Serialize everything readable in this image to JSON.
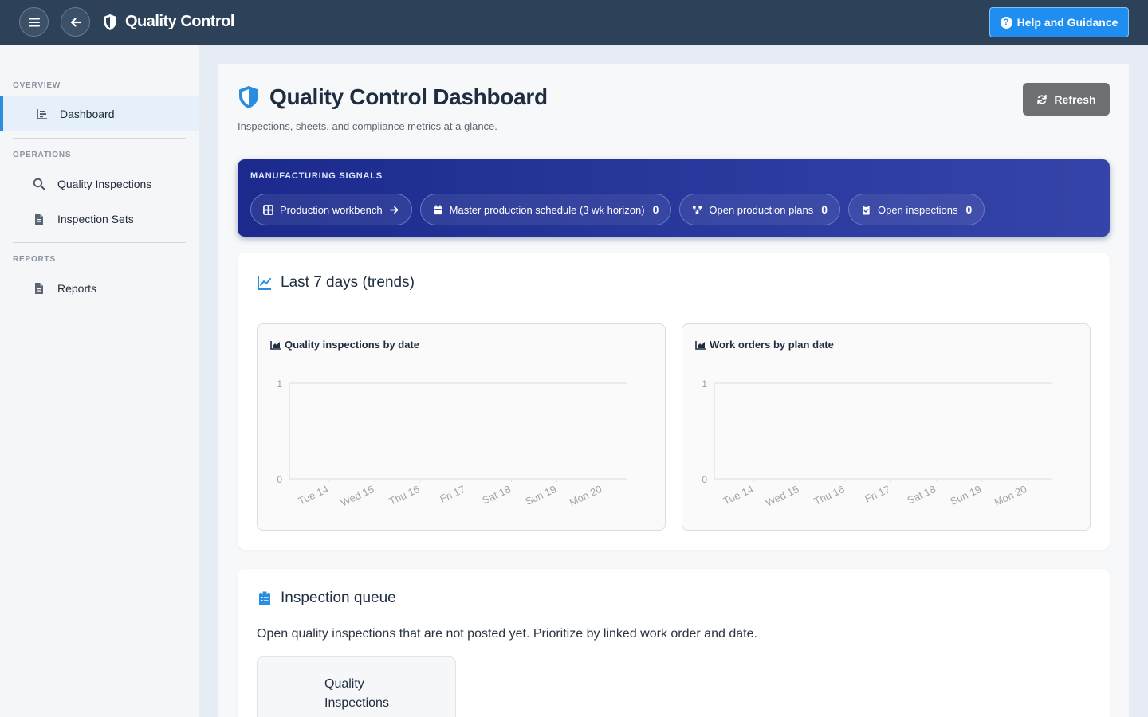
{
  "topbar": {
    "app_title": "Quality Control",
    "help_label": "Help and Guidance",
    "menu_icon": "hamburger-icon",
    "back_icon": "arrow-left-icon",
    "brand_icon": "shield-icon"
  },
  "sidebar": {
    "sections": [
      {
        "label": "OVERVIEW",
        "items": [
          {
            "label": "Dashboard",
            "icon": "chart-bar-icon",
            "active": true
          }
        ]
      },
      {
        "label": "OPERATIONS",
        "items": [
          {
            "label": "Quality Inspections",
            "icon": "search-icon"
          },
          {
            "label": "Inspection Sets",
            "icon": "document-icon"
          }
        ]
      },
      {
        "label": "REPORTS",
        "items": [
          {
            "label": "Reports",
            "icon": "document-icon"
          }
        ]
      }
    ]
  },
  "dashboard": {
    "title": "Quality Control Dashboard",
    "subtitle": "Inspections, sheets, and compliance metrics at a glance.",
    "refresh_label": "Refresh"
  },
  "signals": {
    "label": "MANUFACTURING SIGNALS",
    "chips": [
      {
        "label": "Production workbench",
        "icon": "grid-icon",
        "trailing": "arrow-right-icon"
      },
      {
        "label": "Master production schedule (3 wk horizon)",
        "icon": "calendar-icon",
        "count": "0"
      },
      {
        "label": "Open production plans",
        "icon": "sitemap-icon",
        "count": "0"
      },
      {
        "label": "Open inspections",
        "icon": "clipboard-check-icon",
        "count": "0"
      }
    ]
  },
  "trends": {
    "title": "Last 7 days (trends)",
    "icon": "line-chart-icon"
  },
  "chart_data": [
    {
      "type": "area",
      "title": "Quality inspections by date",
      "categories": [
        "Tue 14",
        "Wed 15",
        "Thu 16",
        "Fri 17",
        "Sat 18",
        "Sun 19",
        "Mon 20"
      ],
      "values": [
        0,
        0,
        0,
        0,
        0,
        0,
        0
      ],
      "yticks": [
        "0",
        "1"
      ],
      "ylim": [
        0,
        1
      ],
      "xlabel": "",
      "ylabel": ""
    },
    {
      "type": "area",
      "title": "Work orders by plan date",
      "categories": [
        "Tue 14",
        "Wed 15",
        "Thu 16",
        "Fri 17",
        "Sat 18",
        "Sun 19",
        "Mon 20"
      ],
      "values": [
        0,
        0,
        0,
        0,
        0,
        0,
        0
      ],
      "yticks": [
        "0",
        "1"
      ],
      "ylim": [
        0,
        1
      ],
      "xlabel": "",
      "ylabel": ""
    }
  ],
  "queue": {
    "title": "Inspection queue",
    "icon": "clipboard-list-icon",
    "description": "Open quality inspections that are not posted yet. Prioritize by linked work order and date.",
    "tile_label": "Quality Inspections"
  },
  "colors": {
    "topbar": "#2d4259",
    "accent": "#1f8ef1",
    "signals_bg": "#1b2a8c"
  }
}
